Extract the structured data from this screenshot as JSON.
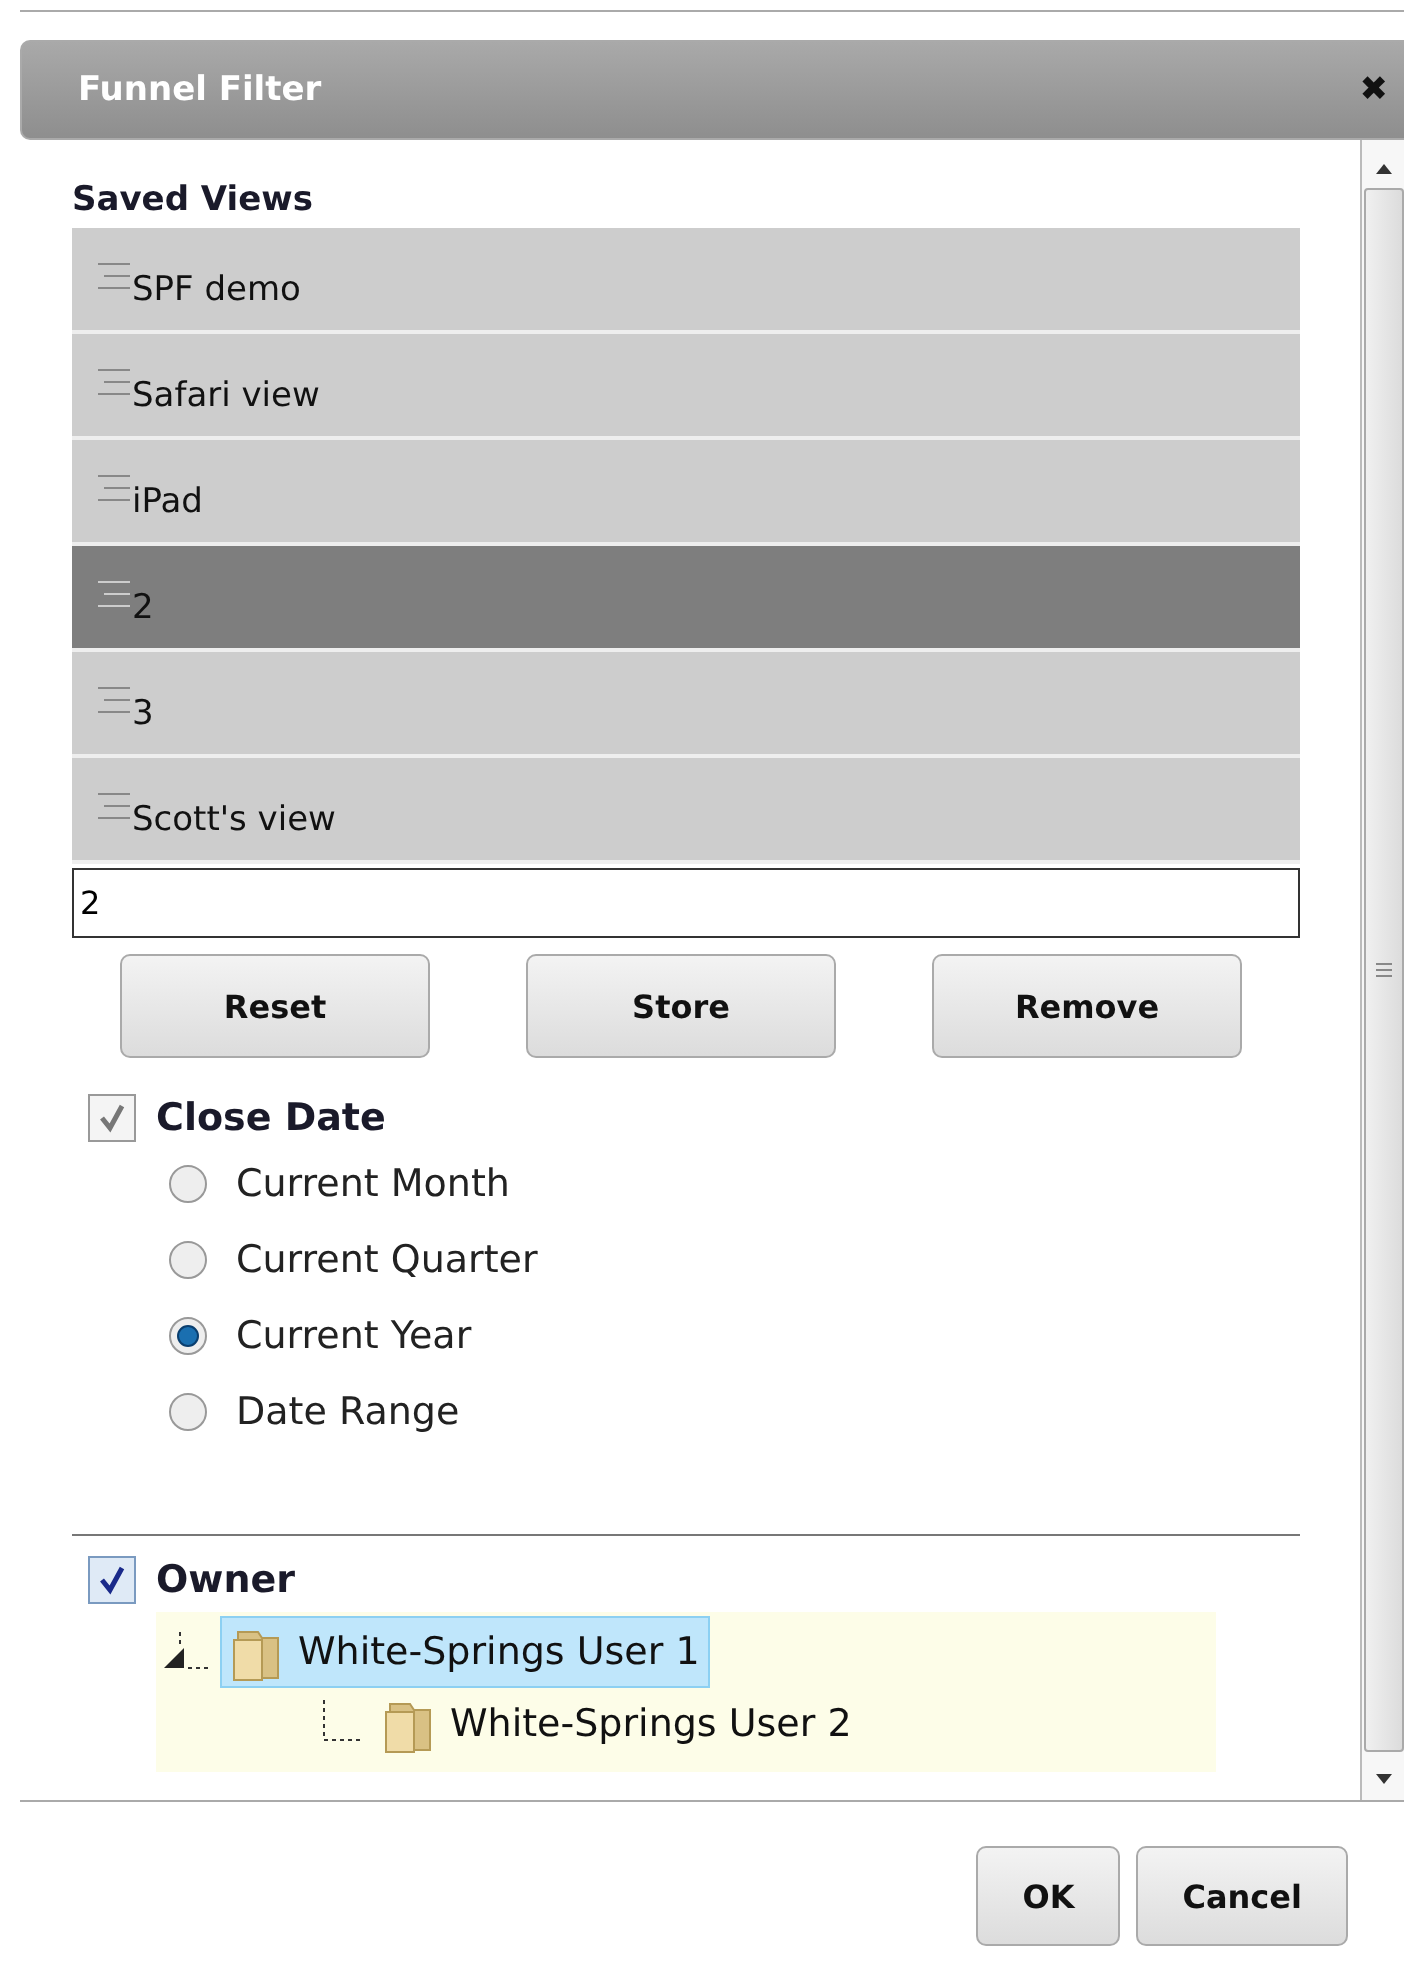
{
  "dialog": {
    "title": "Funnel Filter",
    "close": "✖"
  },
  "saved_views": {
    "heading": "Saved Views",
    "items": [
      {
        "label": "SPF demo",
        "selected": false
      },
      {
        "label": "Safari view",
        "selected": false
      },
      {
        "label": "iPad",
        "selected": false
      },
      {
        "label": "2",
        "selected": true
      },
      {
        "label": "3",
        "selected": false
      },
      {
        "label": "Scott's view",
        "selected": false
      }
    ],
    "name_field": {
      "value": "2"
    },
    "buttons": [
      "Reset",
      "Store",
      "Remove"
    ]
  },
  "close_date": {
    "label": "Close Date",
    "checked": true,
    "disabled": true,
    "options": [
      {
        "label": "Current Month",
        "selected": false
      },
      {
        "label": "Current Quarter",
        "selected": false
      },
      {
        "label": "Current Year",
        "selected": true
      },
      {
        "label": "Date Range",
        "selected": false
      }
    ]
  },
  "owner": {
    "label": "Owner",
    "checked": true,
    "disabled": false,
    "tree": [
      {
        "label": "White-Springs User 1",
        "selected": true,
        "expanded": true,
        "children": [
          {
            "label": "White-Springs User 2",
            "selected": false
          }
        ]
      }
    ]
  },
  "footer_buttons": [
    "OK",
    "Cancel"
  ]
}
